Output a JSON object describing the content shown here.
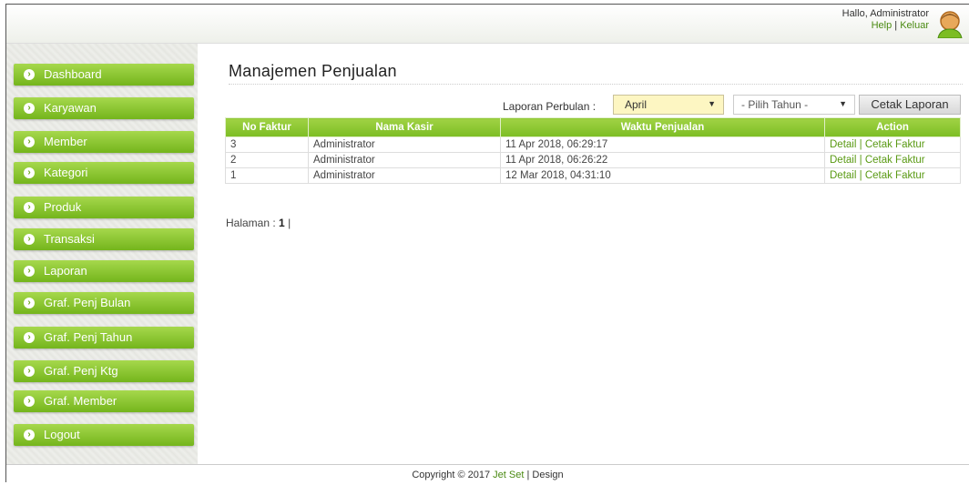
{
  "header": {
    "greeting": "Hallo, Administrator",
    "help_label": "Help",
    "separator": "|",
    "logout_label": "Keluar",
    "avatar_icon": "user-avatar-icon"
  },
  "sidebar": {
    "items": [
      {
        "label": "Dashboard"
      },
      {
        "label": "Karyawan"
      },
      {
        "label": "Member"
      },
      {
        "label": "Kategori"
      },
      {
        "label": "Produk"
      },
      {
        "label": "Transaksi"
      },
      {
        "label": "Laporan"
      },
      {
        "label": "Graf. Penj Bulan"
      },
      {
        "label": "Graf. Penj Tahun"
      },
      {
        "label": "Graf. Penj Ktg"
      },
      {
        "label": "Graf. Member"
      },
      {
        "label": "Logout"
      }
    ],
    "bullet_icon": "chevron-right-circle-icon"
  },
  "main": {
    "title": "Manajemen Penjualan",
    "filter_label": "Laporan Perbulan :",
    "month_selected": "April",
    "year_selected": "- Pilih Tahun -",
    "print_report_label": "Cetak Laporan",
    "table": {
      "headers": [
        "No Faktur",
        "Nama Kasir",
        "Waktu Penjualan",
        "Action"
      ],
      "rows": [
        {
          "no": "3",
          "kasir": "Administrator",
          "waktu": "11 Apr 2018, 06:29:17",
          "detail": "Detail",
          "cetak": "Cetak Faktur"
        },
        {
          "no": "2",
          "kasir": "Administrator",
          "waktu": "11 Apr 2018, 06:26:22",
          "detail": "Detail",
          "cetak": "Cetak Faktur"
        },
        {
          "no": "1",
          "kasir": "Administrator",
          "waktu": "12 Mar 2018, 04:31:10",
          "detail": "Detail",
          "cetak": "Cetak Faktur"
        }
      ],
      "action_separator": "|"
    },
    "pagination_label": "Halaman :",
    "pagination_current": "1",
    "pagination_suffix": "|"
  },
  "footer": {
    "copyright_prefix": "Copyright © 2017",
    "brand_link": "Jet Set",
    "suffix": "| Design"
  },
  "colors": {
    "accent_green": "#7cbd24",
    "link_green": "#5a9a14",
    "select_highlight": "#fdf6c2"
  }
}
